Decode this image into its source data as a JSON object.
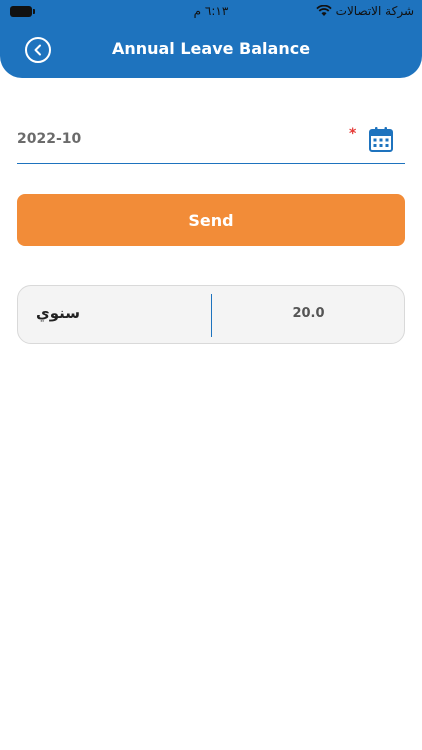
{
  "status_bar": {
    "time": "٦:١٣ م",
    "carrier": "شركة الاتصالات"
  },
  "header": {
    "title": "Annual Leave Balance"
  },
  "form": {
    "date_value": "2022-10",
    "required_mark": "*",
    "send_label": "Send"
  },
  "result": {
    "label": "سنوي",
    "value": "20.0"
  },
  "colors": {
    "primary": "#1e73be",
    "accent": "#f28c38",
    "required": "#e53935"
  },
  "icons": {
    "back": "chevron-left-circle-icon",
    "calendar": "calendar-icon",
    "wifi": "wifi-icon",
    "battery": "battery-icon"
  }
}
